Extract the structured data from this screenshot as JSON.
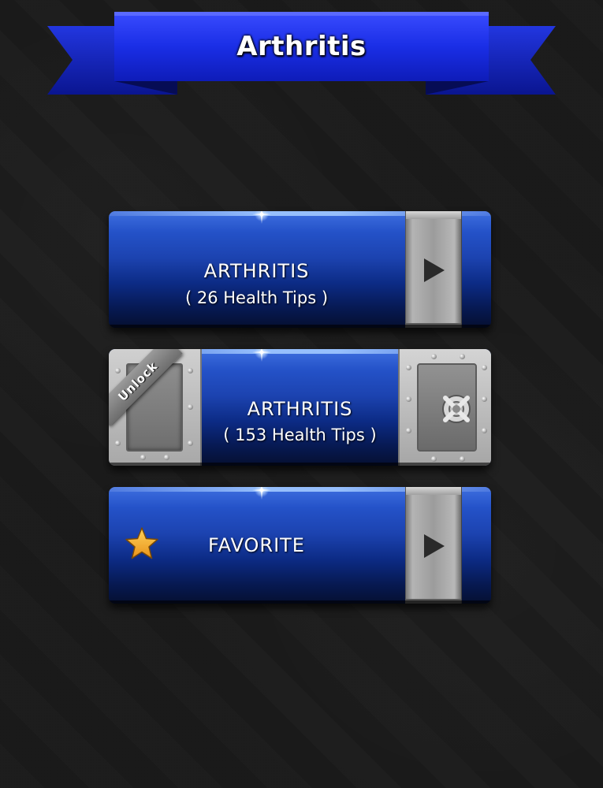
{
  "header": {
    "title": "Arthritis"
  },
  "menu": {
    "arthritis_free": {
      "title": "ARTHRITIS",
      "subtitle": "( 26 Health Tips )"
    },
    "arthritis_locked": {
      "title": "ARTHRITIS",
      "subtitle": "( 153 Health Tips )",
      "unlock_label": "Unlock"
    },
    "favorite": {
      "title": "FAVORITE"
    }
  },
  "colors": {
    "background": "#1a1a1a",
    "ribbon_blue": "#1a2ee6",
    "button_blue": "#1c43b0",
    "metal": "#a8a8a8",
    "star": "#f5a623"
  },
  "icons": {
    "play": "play-icon",
    "vault": "vault-icon",
    "star": "star-icon"
  }
}
